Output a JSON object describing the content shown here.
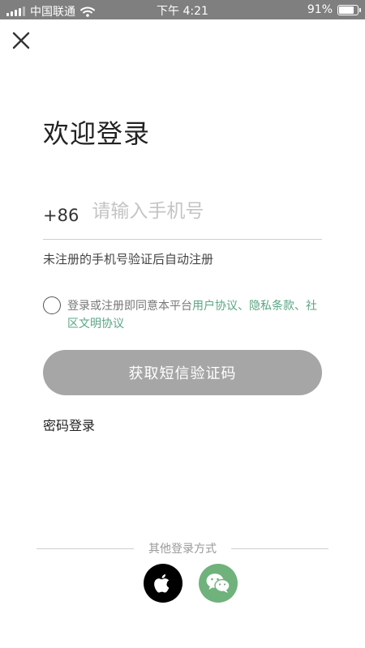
{
  "status_bar": {
    "carrier": "中国联通",
    "time": "下午 4:21",
    "battery": "91%",
    "battery_level": 0.91
  },
  "title": "欢迎登录",
  "phone": {
    "country_code": "+86",
    "placeholder": "请输入手机号",
    "value": ""
  },
  "hint": "未注册的手机号验证后自动注册",
  "agreement": {
    "prefix": "登录或注册即同意本平台",
    "user_agreement": "用户协议",
    "sep1": "、",
    "privacy": "隐私条款",
    "sep2": "、",
    "community": "社区文明协议",
    "link_color": "#5aa583"
  },
  "get_code_button": "获取短信验证码",
  "password_login": "密码登录",
  "other_login": {
    "label": "其他登录方式",
    "methods": [
      {
        "name": "apple-icon",
        "bg": "#000000"
      },
      {
        "name": "wechat-icon",
        "bg": "#6fb27c"
      }
    ]
  }
}
